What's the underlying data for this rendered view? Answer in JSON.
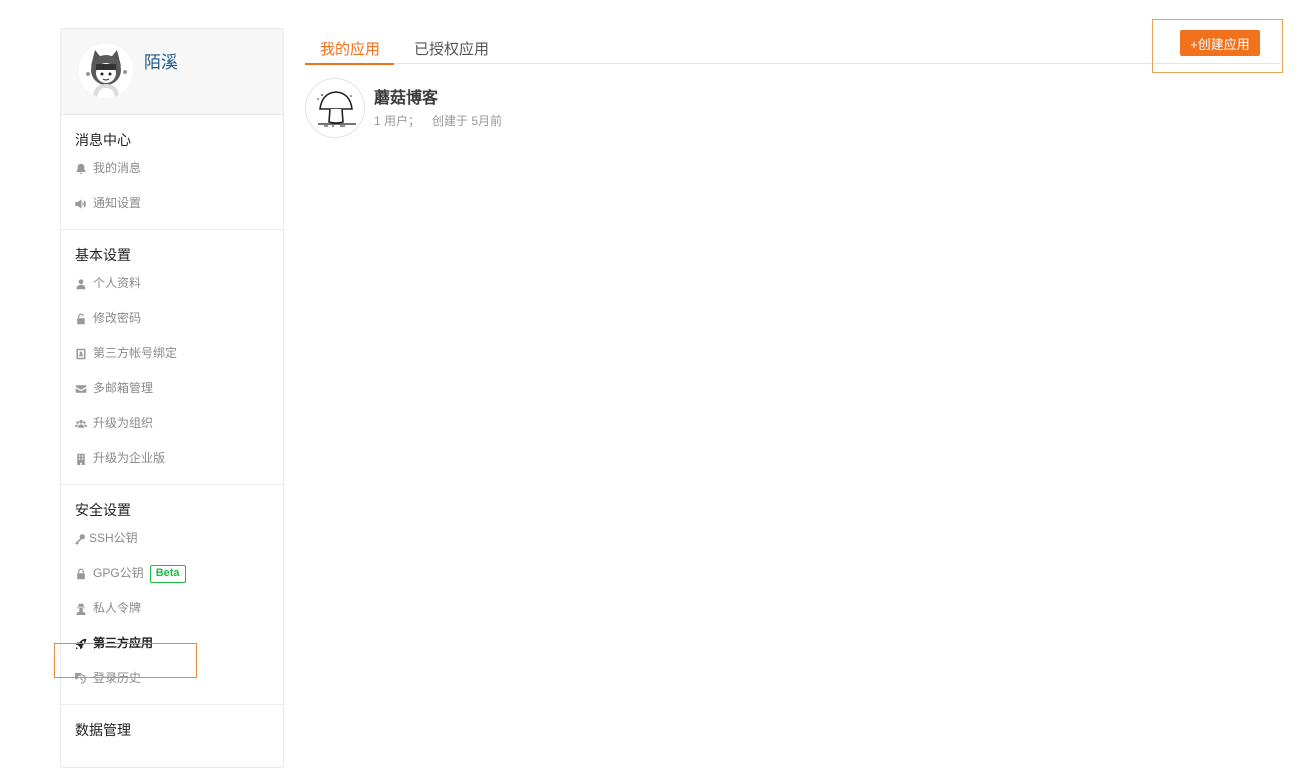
{
  "profile": {
    "username": "陌溪"
  },
  "sidebar": {
    "sections": [
      {
        "title": "消息中心",
        "items": [
          {
            "label": "我的消息",
            "icon": "bell-icon"
          },
          {
            "label": "通知设置",
            "icon": "volume-icon"
          }
        ]
      },
      {
        "title": "基本设置",
        "items": [
          {
            "label": "个人资料",
            "icon": "user-icon"
          },
          {
            "label": "修改密码",
            "icon": "unlock-icon"
          },
          {
            "label": "第三方帐号绑定",
            "icon": "id-card-icon"
          },
          {
            "label": "多邮箱管理",
            "icon": "mail-icon"
          },
          {
            "label": "升级为组织",
            "icon": "users-icon"
          },
          {
            "label": "升级为企业版",
            "icon": "building-icon"
          }
        ]
      },
      {
        "title": "安全设置",
        "items": [
          {
            "label": "SSH公钥",
            "icon": "key-icon"
          },
          {
            "label": "GPG公钥",
            "icon": "lock-icon",
            "badge": "Beta"
          },
          {
            "label": "私人令牌",
            "icon": "user-secret-icon"
          },
          {
            "label": "第三方应用",
            "icon": "rocket-icon",
            "active": true
          },
          {
            "label": "登录历史",
            "icon": "history-icon"
          }
        ]
      },
      {
        "title": "数据管理",
        "items": []
      }
    ]
  },
  "tabs": [
    {
      "label": "我的应用",
      "active": true
    },
    {
      "label": "已授权应用",
      "active": false
    }
  ],
  "create_button": {
    "label": "+创建应用"
  },
  "apps": [
    {
      "name": "蘑菇博客",
      "users": "1 用户；",
      "created": "创建于 5月前"
    }
  ],
  "colors": {
    "accent": "#f2711c",
    "beta": "#21ba45",
    "username": "#1f5a8c"
  }
}
